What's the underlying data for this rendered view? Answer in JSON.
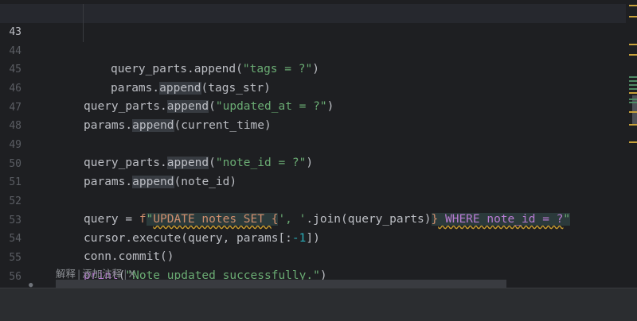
{
  "editor": {
    "lines": [
      {
        "num": "43",
        "indent": 2,
        "current": true
      },
      {
        "num": "44",
        "indent": 2
      },
      {
        "num": "45"
      },
      {
        "num": "46",
        "indent": 1
      },
      {
        "num": "47",
        "indent": 1
      },
      {
        "num": "48"
      },
      {
        "num": "49",
        "indent": 1
      },
      {
        "num": "50",
        "indent": 1
      },
      {
        "num": "51"
      },
      {
        "num": "52",
        "indent": 1
      },
      {
        "num": "53",
        "indent": 1
      },
      {
        "num": "54",
        "indent": 1
      },
      {
        "num": "55",
        "indent": 1
      },
      {
        "num": "56"
      }
    ],
    "code": {
      "l43": {
        "obj": "query_parts",
        "dot": ".",
        "fn": "append",
        "open": "(",
        "str": "\"tags = ?\"",
        "close": ")"
      },
      "l44": {
        "obj": "params",
        "dot": ".",
        "fn": "append",
        "open": "(",
        "arg": "tags_str",
        "close": ")"
      },
      "l46": {
        "obj": "query_parts",
        "dot": ".",
        "fn": "append",
        "open": "(",
        "str": "\"updated_at = ?\"",
        "close": ")"
      },
      "l47": {
        "obj": "params",
        "dot": ".",
        "fn": "append",
        "open": "(",
        "arg": "current_time",
        "close": ")"
      },
      "l49": {
        "obj": "query_parts",
        "dot": ".",
        "fn": "append",
        "open": "(",
        "str": "\"note_id = ?\"",
        "close": ")"
      },
      "l50": {
        "obj": "params",
        "dot": ".",
        "fn": "append",
        "open": "(",
        "arg": "note_id",
        "close": ")"
      },
      "l52": {
        "lhs": "query = ",
        "prefix": "f",
        "q1": "\"",
        "sql1": "UPDATE notes SET ",
        "brace1": "{",
        "sep_str": "', '",
        "join": ".join(query_parts)",
        "brace2": "}",
        "sql2": " WHERE note_id = ?",
        "q2": "\""
      },
      "l53": {
        "pre": "cursor.execute(query, params[:",
        "num": "-1",
        "post": "])"
      },
      "l54": {
        "text": "conn.commit()"
      },
      "l55": {
        "fn": "print",
        "open": "(",
        "str": "\"Note updated successfully.\"",
        "close": ")"
      }
    }
  },
  "inlay_hint": {
    "explain": "解释",
    "sep": "|",
    "add_comment": "添加注释",
    "close": "X"
  },
  "colors": {
    "background": "#1e1f22",
    "string": "#6aab73",
    "number": "#2aacb8",
    "builtin": "#b87bd3",
    "format_brace": "#cf8e6d"
  }
}
